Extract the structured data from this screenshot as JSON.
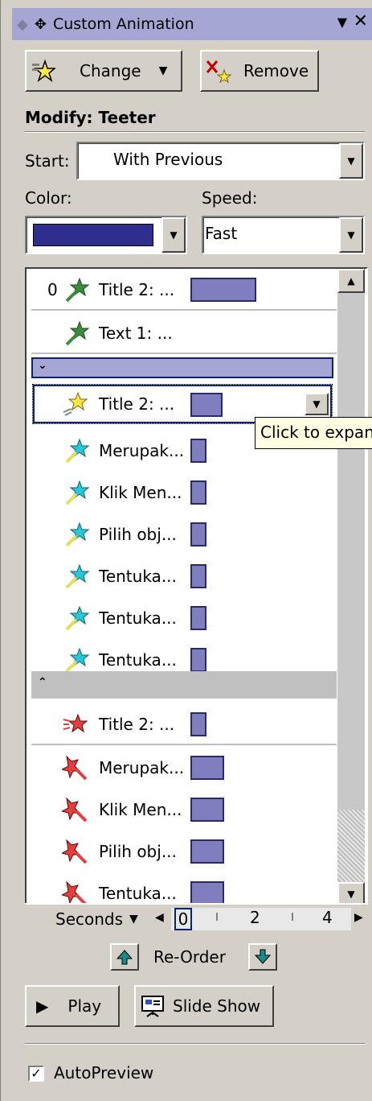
{
  "header": {
    "title": "Custom Animation"
  },
  "toolbar": {
    "change_label": "Change",
    "remove_label": "Remove"
  },
  "modify": {
    "heading": "Modify: Teeter"
  },
  "start": {
    "label": "Start:",
    "value": "With Previous"
  },
  "color": {
    "label": "Color:",
    "swatch": "#2e2e8f"
  },
  "speed": {
    "label": "Speed:",
    "value": "Fast"
  },
  "list": {
    "items": [
      {
        "num": "0",
        "name": "Title 2: ...",
        "icon": "green-star-icon"
      },
      {
        "num": "",
        "name": "Text 1: ...",
        "icon": "green-star-icon"
      },
      {
        "num": "",
        "name": "Title 2: ...",
        "icon": "yellow-star-icon"
      },
      {
        "num": "",
        "name": "Merupak...",
        "icon": "cyan-star-icon"
      },
      {
        "num": "",
        "name": "Klik Men...",
        "icon": "cyan-star-icon"
      },
      {
        "num": "",
        "name": "Pilih obj...",
        "icon": "cyan-star-icon"
      },
      {
        "num": "",
        "name": "Tentuka...",
        "icon": "cyan-star-icon"
      },
      {
        "num": "",
        "name": "Tentuka...",
        "icon": "cyan-star-icon"
      },
      {
        "num": "",
        "name": "Tentuka...",
        "icon": "cyan-star-icon"
      },
      {
        "num": "",
        "name": "Title 2: ...",
        "icon": "red-star-icon"
      },
      {
        "num": "",
        "name": "Merupak...",
        "icon": "red-star-icon"
      },
      {
        "num": "",
        "name": "Klik Men...",
        "icon": "red-star-icon"
      },
      {
        "num": "",
        "name": "Pilih obj...",
        "icon": "red-star-icon"
      },
      {
        "num": "",
        "name": "Tentuka...",
        "icon": "red-star-icon"
      }
    ]
  },
  "tooltip": {
    "text": "Click to expand"
  },
  "timeline": {
    "unit": "Seconds",
    "ticks": [
      "0",
      "2",
      "4"
    ]
  },
  "reorder": {
    "label": "Re-Order"
  },
  "play": {
    "label": "Play"
  },
  "slideshow": {
    "label": "Slide Show"
  },
  "autopreview": {
    "label": "AutoPreview",
    "checked": true
  },
  "colors": {
    "bar": "#7f7fbf",
    "titlebar": "#a6a6d4",
    "selection": "#0a246a"
  }
}
